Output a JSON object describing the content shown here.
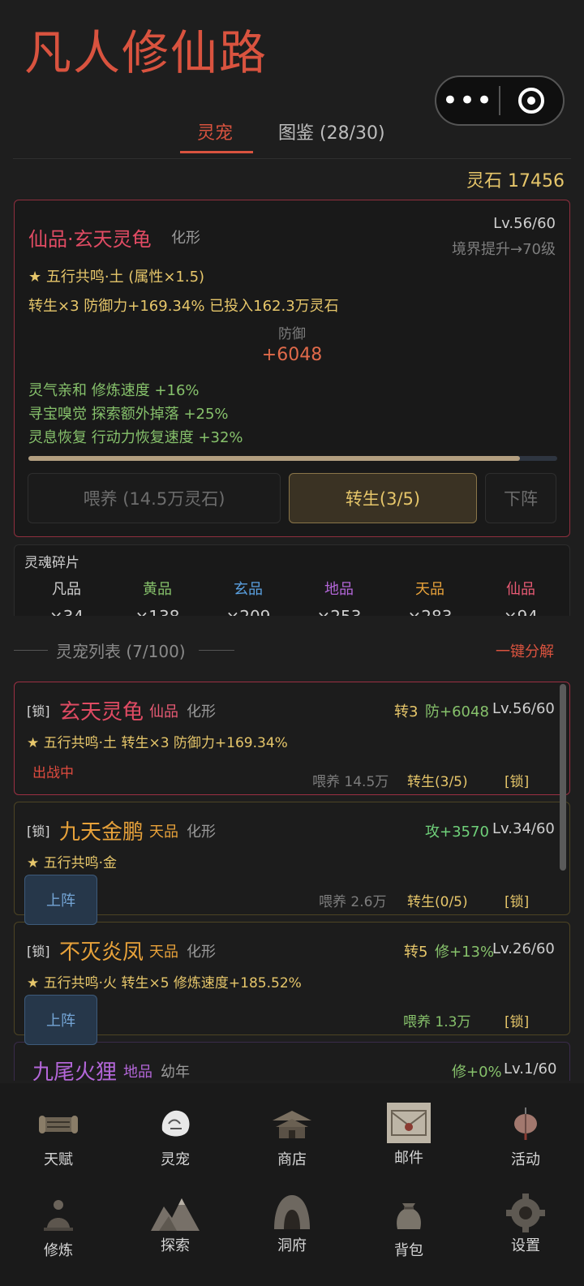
{
  "app": {
    "title": "凡人修仙路",
    "capsule": {
      "more_icon": "ellipsis-icon",
      "close_icon": "target-icon"
    }
  },
  "tabs": [
    {
      "label": "灵宠"
    },
    {
      "label": "图鉴 (28/30)"
    }
  ],
  "currency": {
    "label": "灵石 17456"
  },
  "detail": {
    "name": "仙品·玄天灵龟",
    "stage": "化形",
    "level": "Lv.56/60",
    "realm": "境界提升→70级",
    "resonance": "★ 五行共鸣·土 (属性×1.5)",
    "rebirth_line": "转生×3  防御力+169.34%  已投入162.3万灵石",
    "stat_label": "防御",
    "stat_value": "+6048",
    "skills": [
      "灵气亲和 修炼速度 +16%",
      "寻宝嗅觉 探索额外掉落 +25%",
      "灵息恢复 行动力恢复速度 +32%"
    ],
    "progress": 0.93,
    "feed_label": "喂养 (14.5万灵石)",
    "rebirth_label": "转生(3/5)",
    "unequip_label": "下阵"
  },
  "soul": {
    "title": "灵魂碎片",
    "tiers": [
      {
        "name": "凡品",
        "count": "×34",
        "color": "#cfcfcf"
      },
      {
        "name": "黄品",
        "count": "×138",
        "color": "#86c16b"
      },
      {
        "name": "玄品",
        "count": "×209",
        "color": "#5aa0e0"
      },
      {
        "name": "地品",
        "count": "×253",
        "color": "#b366d8"
      },
      {
        "name": "天品",
        "count": "×283",
        "color": "#e8a23a"
      },
      {
        "name": "仙品",
        "count": "×94",
        "color": "#e85a74"
      }
    ]
  },
  "list": {
    "title": "灵宠列表 (7/100)",
    "decompose_label": "一键分解",
    "pets": [
      {
        "lock": "[锁]",
        "name": "玄天灵龟",
        "grade": "仙品",
        "stage": "化形",
        "rebirth": "转3",
        "stat": "防+6048",
        "level": "Lv.56/60",
        "trait": "★ 五行共鸣·土  转生×3 防御力+169.34%",
        "status": "出战中",
        "feed": "喂养 14.5万",
        "rebirth_btn": "转生(3/5)",
        "lock_btn": "[锁]"
      },
      {
        "lock": "[锁]",
        "name": "九天金鹏",
        "grade": "天品",
        "stage": "化形",
        "stat": "攻+3570",
        "level": "Lv.34/60",
        "trait": "★ 五行共鸣·金",
        "deploy": "上阵",
        "feed": "喂养 2.6万",
        "rebirth_btn": "转生(0/5)",
        "lock_btn": "[锁]"
      },
      {
        "lock": "[锁]",
        "name": "不灭炎凤",
        "grade": "天品",
        "stage": "化形",
        "rebirth": "转5",
        "stat": "修+13%",
        "level": "Lv.26/60",
        "trait": "★ 五行共鸣·火  转生×5 修炼速度+185.52%",
        "deploy": "上阵",
        "feed": "喂养 1.3万",
        "lock_btn": "[锁]"
      },
      {
        "name": "九尾火狸",
        "grade": "地品",
        "stage": "幼年",
        "stat": "修+0%",
        "level": "Lv.1/60"
      }
    ]
  },
  "nav": [
    {
      "label": "天赋",
      "icon": "scroll-icon"
    },
    {
      "label": "灵宠",
      "icon": "spirit-pet-icon"
    },
    {
      "label": "商店",
      "icon": "pavilion-icon"
    },
    {
      "label": "邮件",
      "icon": "mail-icon"
    },
    {
      "label": "活动",
      "icon": "lantern-icon"
    },
    {
      "label": "修炼",
      "icon": "meditation-icon"
    },
    {
      "label": "探索",
      "icon": "mountain-icon"
    },
    {
      "label": "洞府",
      "icon": "cave-icon"
    },
    {
      "label": "背包",
      "icon": "bag-icon"
    },
    {
      "label": "设置",
      "icon": "gear-icon"
    }
  ]
}
